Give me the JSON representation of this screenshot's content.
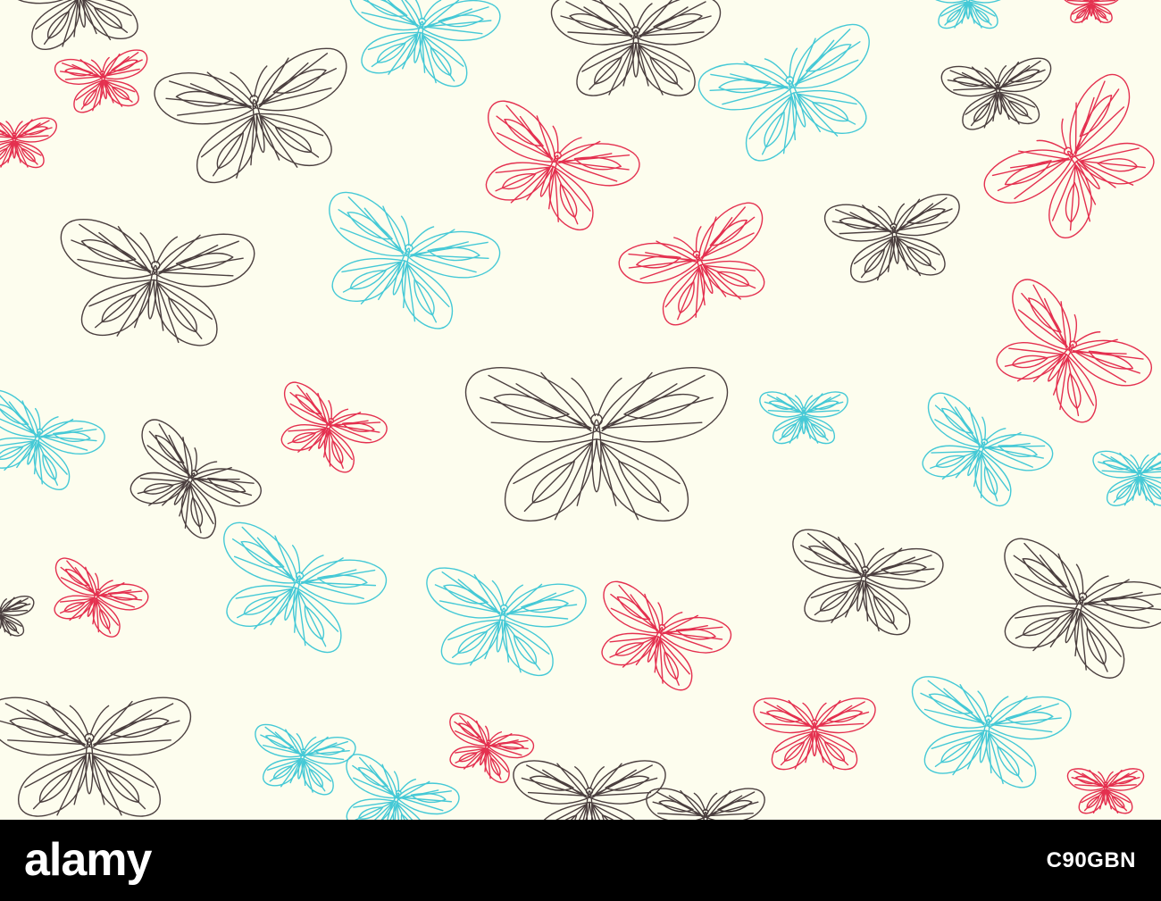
{
  "image": {
    "subject": "butterfly-outline-pattern",
    "background_color": "#fdfdee",
    "palette": {
      "dark": "#4b3f3f",
      "cyan": "#45c9d6",
      "red": "#e4304f"
    }
  },
  "footer": {
    "background_color": "#000000",
    "text_color": "#ffffff",
    "logo_text": "alamy",
    "image_id": "C90GBN"
  }
}
